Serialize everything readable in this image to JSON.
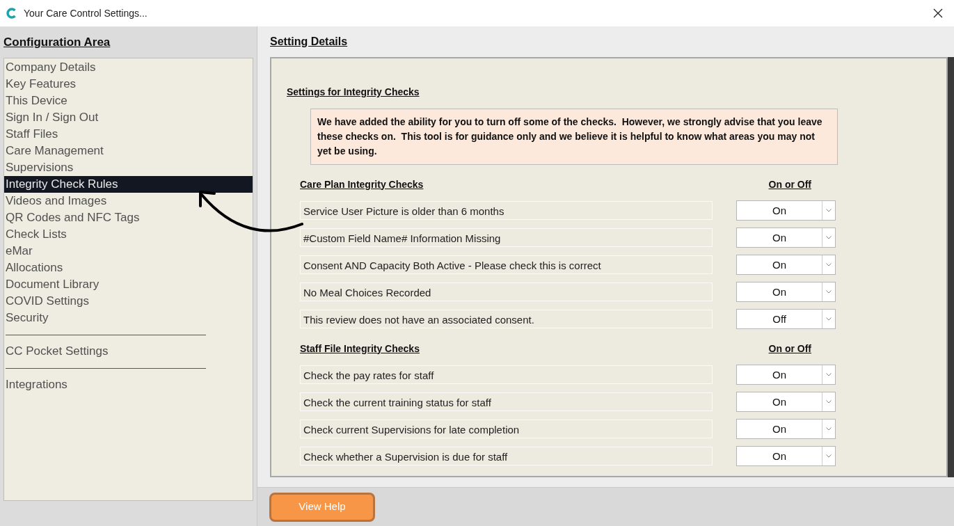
{
  "window": {
    "title": "Your Care Control Settings..."
  },
  "sidebar": {
    "heading": "Configuration Area",
    "groups": [
      {
        "items": [
          {
            "label": "Company Details",
            "selected": false
          },
          {
            "label": "Key Features",
            "selected": false
          },
          {
            "label": "This Device",
            "selected": false
          },
          {
            "label": "Sign In / Sign Out",
            "selected": false
          },
          {
            "label": "Staff Files",
            "selected": false
          },
          {
            "label": "Care Management",
            "selected": false
          },
          {
            "label": "Supervisions",
            "selected": false
          },
          {
            "label": "Integrity Check Rules",
            "selected": true
          },
          {
            "label": "Videos and Images",
            "selected": false
          },
          {
            "label": "QR Codes and NFC Tags",
            "selected": false
          },
          {
            "label": "Check Lists",
            "selected": false
          },
          {
            "label": "eMar",
            "selected": false
          },
          {
            "label": "Allocations",
            "selected": false
          },
          {
            "label": "Document Library",
            "selected": false
          },
          {
            "label": "COVID Settings",
            "selected": false
          },
          {
            "label": "Security",
            "selected": false
          }
        ]
      },
      {
        "items": [
          {
            "label": "CC Pocket Settings",
            "selected": false
          }
        ]
      },
      {
        "items": [
          {
            "label": "Integrations",
            "selected": false
          }
        ]
      }
    ]
  },
  "details": {
    "heading": "Setting Details",
    "title": "Settings for Integrity Checks",
    "notice": "We have added the ability for you to turn off some of the checks.  However, we strongly advise that you leave these checks on.  This tool is for guidance only and we believe it is helpful to know what areas you may not yet be using.",
    "sections": [
      {
        "title": "Care Plan Integrity Checks",
        "column_title": "On or Off",
        "rows": [
          {
            "label": "Service User Picture is older than 6 months",
            "value": "On"
          },
          {
            "label": "#Custom Field Name# Information Missing",
            "value": "On"
          },
          {
            "label": "Consent AND Capacity Both Active - Please check this is correct",
            "value": "On"
          },
          {
            "label": "No Meal Choices Recorded",
            "value": "On"
          },
          {
            "label": "This review does not have an associated consent.",
            "value": "Off"
          }
        ]
      },
      {
        "title": "Staff File Integrity Checks",
        "column_title": "On or Off",
        "rows": [
          {
            "label": "Check the pay rates for staff",
            "value": "On"
          },
          {
            "label": "Check the current training status for staff",
            "value": "On"
          },
          {
            "label": "Check current Supervisions for late completion",
            "value": "On"
          },
          {
            "label": "Check whether a Supervision is due for staff",
            "value": "On"
          }
        ]
      }
    ]
  },
  "footer": {
    "button": "View Help"
  }
}
